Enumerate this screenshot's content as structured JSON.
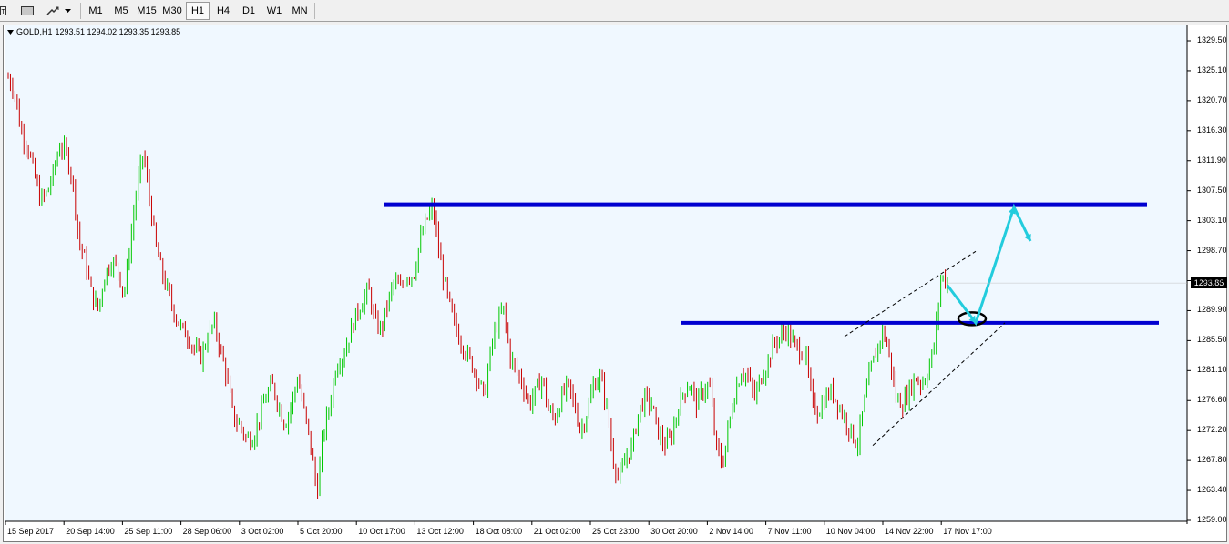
{
  "toolbar": {
    "timeframes": [
      "M1",
      "M5",
      "M15",
      "M30",
      "H1",
      "H4",
      "D1",
      "W1",
      "MN"
    ],
    "active_timeframe": "H1",
    "icons": [
      "text-tool-icon",
      "rectangle-tool-icon",
      "drawing-tools-icon",
      "dropdown-arrow-icon"
    ]
  },
  "chart": {
    "symbol_label": "GOLD,H1",
    "ohlc": "1293.51 1294.02 1293.35 1293.85",
    "current_price": "1293.85",
    "y_ticks": [
      "1329.50",
      "1325.10",
      "1320.70",
      "1316.30",
      "1311.90",
      "1307.50",
      "1303.10",
      "1298.70",
      "1294.30",
      "1289.90",
      "1285.50",
      "1281.10",
      "1276.60",
      "1272.20",
      "1267.80",
      "1263.40",
      "1259.00"
    ],
    "x_ticks": [
      "15 Sep 2017",
      "20 Sep 14:00",
      "25 Sep 11:00",
      "28 Sep 06:00",
      "3 Oct 02:00",
      "5 Oct 20:00",
      "10 Oct 17:00",
      "13 Oct 12:00",
      "18 Oct 08:00",
      "21 Oct 02:00",
      "25 Oct 23:00",
      "30 Oct 20:00",
      "2 Nov 14:00",
      "7 Nov 11:00",
      "10 Nov 04:00",
      "14 Nov 22:00",
      "17 Nov 17:00"
    ],
    "colors": {
      "background": "#f0f8ff",
      "bull": "#00c800",
      "bear": "#c80000",
      "level_lines": "#0000d0",
      "projection_arrow": "#22ccdd"
    }
  },
  "chart_data": {
    "type": "candlestick",
    "symbol": "GOLD",
    "timeframe": "H1",
    "ylim": [
      1259.0,
      1331.0
    ],
    "close_path": [
      [
        "15 Sep 2017",
        1324
      ],
      [
        "",
        1322
      ],
      [
        "",
        1316
      ],
      [
        "",
        1314
      ],
      [
        "",
        1310
      ],
      [
        "",
        1306
      ],
      [
        "",
        1307
      ],
      [
        "",
        1310
      ],
      [
        "",
        1314
      ],
      [
        "",
        1313
      ],
      [
        "20 Sep 14:00",
        1309
      ],
      [
        "",
        1300
      ],
      [
        "",
        1297
      ],
      [
        "",
        1292
      ],
      [
        "",
        1290
      ],
      [
        "",
        1295
      ],
      [
        "",
        1297
      ],
      [
        "",
        1296
      ],
      [
        "",
        1292
      ],
      [
        "25 Sep 11:00",
        1300
      ],
      [
        "",
        1308
      ],
      [
        "",
        1313
      ],
      [
        "",
        1306
      ],
      [
        "",
        1299
      ],
      [
        "",
        1295
      ],
      [
        "",
        1292
      ],
      [
        "",
        1289
      ],
      [
        "",
        1287
      ],
      [
        "",
        1286
      ],
      [
        "28 Sep 06:00",
        1284
      ],
      [
        "",
        1283
      ],
      [
        "",
        1286
      ],
      [
        "",
        1288
      ],
      [
        "",
        1284
      ],
      [
        "",
        1280
      ],
      [
        "",
        1274
      ],
      [
        "",
        1273
      ],
      [
        "",
        1271
      ],
      [
        "3 Oct 02:00",
        1271
      ],
      [
        "",
        1274
      ],
      [
        "",
        1277
      ],
      [
        "",
        1279
      ],
      [
        "",
        1276
      ],
      [
        "",
        1273
      ],
      [
        "",
        1276
      ],
      [
        "",
        1280
      ],
      [
        "",
        1275
      ],
      [
        "",
        1270
      ],
      [
        "5 Oct 20:00",
        1263
      ],
      [
        "",
        1272
      ],
      [
        "",
        1276
      ],
      [
        "",
        1282
      ],
      [
        "",
        1283
      ],
      [
        "",
        1286
      ],
      [
        "",
        1289
      ],
      [
        "",
        1291
      ],
      [
        "",
        1293
      ],
      [
        "",
        1288
      ],
      [
        "10 Oct 17:00",
        1287
      ],
      [
        "",
        1291
      ],
      [
        "",
        1294
      ],
      [
        "",
        1293
      ],
      [
        "",
        1295
      ],
      [
        "",
        1295
      ],
      [
        "",
        1300
      ],
      [
        "",
        1303
      ],
      [
        "13 Oct 12:00",
        1305
      ],
      [
        "",
        1298
      ],
      [
        "",
        1293
      ],
      [
        "",
        1289
      ],
      [
        "",
        1286
      ],
      [
        "",
        1284
      ],
      [
        "",
        1282
      ],
      [
        "",
        1280
      ],
      [
        "",
        1277
      ],
      [
        "18 Oct 08:00",
        1284
      ],
      [
        "",
        1288
      ],
      [
        "",
        1290
      ],
      [
        "",
        1283
      ],
      [
        "",
        1281
      ],
      [
        "",
        1279
      ],
      [
        "",
        1276
      ],
      [
        "",
        1278
      ],
      [
        "",
        1280
      ],
      [
        "21 Oct 02:00",
        1275
      ],
      [
        "",
        1274
      ],
      [
        "",
        1277
      ],
      [
        "",
        1279
      ],
      [
        "",
        1276
      ],
      [
        "",
        1272
      ],
      [
        "",
        1275
      ],
      [
        "",
        1279
      ],
      [
        "",
        1280
      ],
      [
        "",
        1276
      ],
      [
        "25 Oct 23:00",
        1268
      ],
      [
        "",
        1265
      ],
      [
        "",
        1268
      ],
      [
        "",
        1270
      ],
      [
        "",
        1275
      ],
      [
        "",
        1277
      ],
      [
        "",
        1276
      ],
      [
        "",
        1272
      ],
      [
        "",
        1270
      ],
      [
        "30 Oct 20:00",
        1271
      ],
      [
        "",
        1275
      ],
      [
        "",
        1278
      ],
      [
        "",
        1279
      ],
      [
        "",
        1276
      ],
      [
        "",
        1278
      ],
      [
        "",
        1279
      ],
      [
        "2 Nov 14:00",
        1270
      ],
      [
        "",
        1267
      ],
      [
        "",
        1273
      ],
      [
        "",
        1278
      ],
      [
        "",
        1281
      ],
      [
        "",
        1280
      ],
      [
        "",
        1277
      ],
      [
        "",
        1280
      ],
      [
        "",
        1282
      ],
      [
        "7 Nov 11:00",
        1285
      ],
      [
        "",
        1286
      ],
      [
        "",
        1287
      ],
      [
        "",
        1285
      ],
      [
        "",
        1284
      ],
      [
        "",
        1283
      ],
      [
        "",
        1276
      ],
      [
        "",
        1275
      ],
      [
        "10 Nov 04:00",
        1277
      ],
      [
        "",
        1278
      ],
      [
        "",
        1276
      ],
      [
        "",
        1274
      ],
      [
        "",
        1272
      ],
      [
        "",
        1270
      ],
      [
        "",
        1276
      ],
      [
        "",
        1281
      ],
      [
        "",
        1284
      ],
      [
        "14 Nov 22:00",
        1287
      ],
      [
        "",
        1283
      ],
      [
        "",
        1277
      ],
      [
        "",
        1276
      ],
      [
        "",
        1278
      ],
      [
        "",
        1280
      ],
      [
        "",
        1279
      ],
      [
        "",
        1281
      ],
      [
        "17 Nov 17:00",
        1285
      ],
      [
        "",
        1295
      ],
      [
        "",
        1293.85
      ]
    ],
    "levels": [
      {
        "type": "horizontal",
        "price": 1305.4,
        "from": "10 Oct 17:00",
        "to": "right-edge"
      },
      {
        "type": "horizontal",
        "price": 1288.0,
        "from": "30 Oct 20:00",
        "to": "right-edge"
      }
    ],
    "projection_arrow": [
      1293.5,
      1288.0,
      1305.0,
      1300.0
    ],
    "annotations": [
      "support/resistance rectangle lines",
      "ascending dashed channel",
      "ellipse at retest zone",
      "projected path arrow"
    ]
  }
}
